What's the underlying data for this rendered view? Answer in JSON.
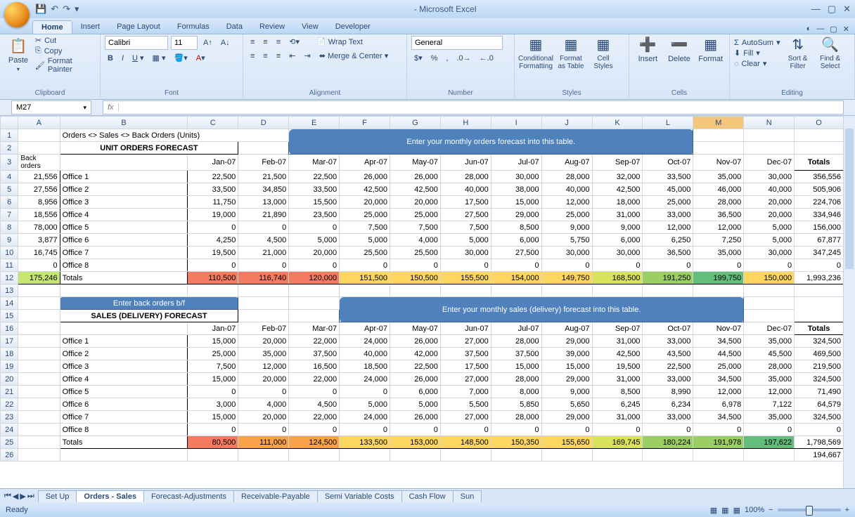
{
  "app_title": " - Microsoft Excel",
  "tabs": [
    "Home",
    "Insert",
    "Page Layout",
    "Formulas",
    "Data",
    "Review",
    "View",
    "Developer"
  ],
  "active_tab": 0,
  "ribbon": {
    "clipboard": {
      "label": "Clipboard",
      "paste": "Paste",
      "cut": "Cut",
      "copy": "Copy",
      "fmt": "Format Painter"
    },
    "font": {
      "label": "Font",
      "name": "Calibri",
      "size": "11"
    },
    "alignment": {
      "label": "Alignment",
      "wrap": "Wrap Text",
      "merge": "Merge & Center"
    },
    "number": {
      "label": "Number",
      "format": "General"
    },
    "styles": {
      "label": "Styles",
      "cond": "Conditional Formatting",
      "table": "Format as Table",
      "cell": "Cell Styles"
    },
    "cells": {
      "label": "Cells",
      "insert": "Insert",
      "delete": "Delete",
      "format": "Format"
    },
    "editing": {
      "label": "Editing",
      "sum": "AutoSum",
      "fill": "Fill",
      "clear": "Clear",
      "sort": "Sort & Filter",
      "find": "Find & Select"
    }
  },
  "namebox": "M27",
  "cols": [
    "A",
    "B",
    "C",
    "D",
    "E",
    "F",
    "G",
    "H",
    "I",
    "J",
    "K",
    "L",
    "M",
    "N",
    "O"
  ],
  "sel_col": 12,
  "months": [
    "Jan-07",
    "Feb-07",
    "Mar-07",
    "Apr-07",
    "May-07",
    "Jun-07",
    "Jul-07",
    "Aug-07",
    "Sep-07",
    "Oct-07",
    "Nov-07",
    "Dec-07"
  ],
  "row1_b": "Orders <> Sales <> Back Orders (Units)",
  "row1_callout": "Enter your monthly  orders forecast into this table.",
  "row2_b": "UNIT ORDERS FORECAST",
  "row3_a": "Back orders",
  "row3_totals": "Totals",
  "orders": [
    {
      "bo": "21,556",
      "name": "Office 1",
      "v": [
        "22,500",
        "21,500",
        "22,500",
        "26,000",
        "26,000",
        "28,000",
        "30,000",
        "28,000",
        "32,000",
        "33,500",
        "35,000",
        "30,000"
      ],
      "tot": "356,556"
    },
    {
      "bo": "27,556",
      "name": "Office 2",
      "v": [
        "33,500",
        "34,850",
        "33,500",
        "42,500",
        "42,500",
        "40,000",
        "38,000",
        "40,000",
        "42,500",
        "45,000",
        "46,000",
        "40,000"
      ],
      "tot": "505,906"
    },
    {
      "bo": "8,956",
      "name": "Office 3",
      "v": [
        "11,750",
        "13,000",
        "15,500",
        "20,000",
        "20,000",
        "17,500",
        "15,000",
        "12,000",
        "18,000",
        "25,000",
        "28,000",
        "20,000"
      ],
      "tot": "224,706"
    },
    {
      "bo": "18,556",
      "name": "Office 4",
      "v": [
        "19,000",
        "21,890",
        "23,500",
        "25,000",
        "25,000",
        "27,500",
        "29,000",
        "25,000",
        "31,000",
        "33,000",
        "36,500",
        "20,000"
      ],
      "tot": "334,946"
    },
    {
      "bo": "78,000",
      "name": "Office 5",
      "v": [
        "0",
        "0",
        "0",
        "7,500",
        "7,500",
        "7,500",
        "8,500",
        "9,000",
        "9,000",
        "12,000",
        "12,000",
        "5,000"
      ],
      "tot": "156,000"
    },
    {
      "bo": "3,877",
      "name": "Office 6",
      "v": [
        "4,250",
        "4,500",
        "5,000",
        "5,000",
        "4,000",
        "5,000",
        "6,000",
        "5,750",
        "6,000",
        "6,250",
        "7,250",
        "5,000"
      ],
      "tot": "67,877"
    },
    {
      "bo": "16,745",
      "name": "Office 7",
      "v": [
        "19,500",
        "21,000",
        "20,000",
        "25,500",
        "25,500",
        "30,000",
        "27,500",
        "30,000",
        "30,000",
        "36,500",
        "35,000",
        "30,000"
      ],
      "tot": "347,245"
    },
    {
      "bo": "0",
      "name": "Office 8",
      "v": [
        "0",
        "0",
        "0",
        "0",
        "0",
        "0",
        "0",
        "0",
        "0",
        "0",
        "0",
        "0"
      ],
      "tot": "0"
    }
  ],
  "orders_tot": {
    "bo": "175,246",
    "name": "Totals",
    "v": [
      "110,500",
      "116,740",
      "120,000",
      "151,500",
      "150,500",
      "155,500",
      "154,000",
      "149,750",
      "168,500",
      "191,250",
      "199,750",
      "150,000"
    ],
    "tot": "1,993,236"
  },
  "row14_btn": "Enter back orders b/f",
  "row14_callout": "Enter your monthly sales (delivery) forecast into this table.",
  "row15_b": "SALES (DELIVERY) FORECAST",
  "sales": [
    {
      "name": "Office 1",
      "v": [
        "15,000",
        "20,000",
        "22,000",
        "24,000",
        "26,000",
        "27,000",
        "28,000",
        "29,000",
        "31,000",
        "33,000",
        "34,500",
        "35,000"
      ],
      "tot": "324,500"
    },
    {
      "name": "Office 2",
      "v": [
        "25,000",
        "35,000",
        "37,500",
        "40,000",
        "42,000",
        "37,500",
        "37,500",
        "39,000",
        "42,500",
        "43,500",
        "44,500",
        "45,500"
      ],
      "tot": "469,500"
    },
    {
      "name": "Office 3",
      "v": [
        "7,500",
        "12,000",
        "16,500",
        "18,500",
        "22,500",
        "17,500",
        "15,000",
        "15,000",
        "19,500",
        "22,500",
        "25,000",
        "28,000"
      ],
      "tot": "219,500"
    },
    {
      "name": "Office 4",
      "v": [
        "15,000",
        "20,000",
        "22,000",
        "24,000",
        "26,000",
        "27,000",
        "28,000",
        "29,000",
        "31,000",
        "33,000",
        "34,500",
        "35,000"
      ],
      "tot": "324,500"
    },
    {
      "name": "Office 5",
      "v": [
        "0",
        "0",
        "0",
        "0",
        "6,000",
        "7,000",
        "8,000",
        "9,000",
        "8,500",
        "8,990",
        "12,000",
        "12,000"
      ],
      "tot": "71,490"
    },
    {
      "name": "Office 6",
      "v": [
        "3,000",
        "4,000",
        "4,500",
        "5,000",
        "5,000",
        "5,500",
        "5,850",
        "5,650",
        "6,245",
        "6,234",
        "6,978",
        "7,122"
      ],
      "tot": "64,579"
    },
    {
      "name": "Office 7",
      "v": [
        "15,000",
        "20,000",
        "22,000",
        "24,000",
        "26,000",
        "27,000",
        "28,000",
        "29,000",
        "31,000",
        "33,000",
        "34,500",
        "35,000"
      ],
      "tot": "324,500"
    },
    {
      "name": "Office 8",
      "v": [
        "0",
        "0",
        "0",
        "0",
        "0",
        "0",
        "0",
        "0",
        "0",
        "0",
        "0",
        "0"
      ],
      "tot": "0"
    }
  ],
  "sales_tot": {
    "name": "Totals",
    "v": [
      "80,500",
      "111,000",
      "124,500",
      "133,500",
      "153,000",
      "148,500",
      "150,350",
      "155,650",
      "169,745",
      "180,224",
      "191,978",
      "197,622"
    ],
    "tot": "1,798,569"
  },
  "row26_tot": "194,667",
  "heat_classes_orders": [
    "heat-r",
    "heat-r",
    "heat-r",
    "heat-y",
    "heat-y",
    "heat-y",
    "heat-y",
    "heat-y",
    "heat-yg",
    "heat-g",
    "heat-gg",
    "heat-y"
  ],
  "heat_classes_sales": [
    "heat-r",
    "heat-o",
    "heat-o",
    "heat-y",
    "heat-y",
    "heat-y",
    "heat-y",
    "heat-y",
    "heat-yg",
    "heat-g",
    "heat-g",
    "heat-gg"
  ],
  "sheet_tabs": [
    "Set Up",
    "Orders - Sales",
    "Forecast-Adjustments",
    "Receivable-Payable",
    "Semi Variable Costs",
    "Cash Flow",
    "Sun"
  ],
  "active_sheet": 1,
  "status": "Ready",
  "zoom": "100%"
}
